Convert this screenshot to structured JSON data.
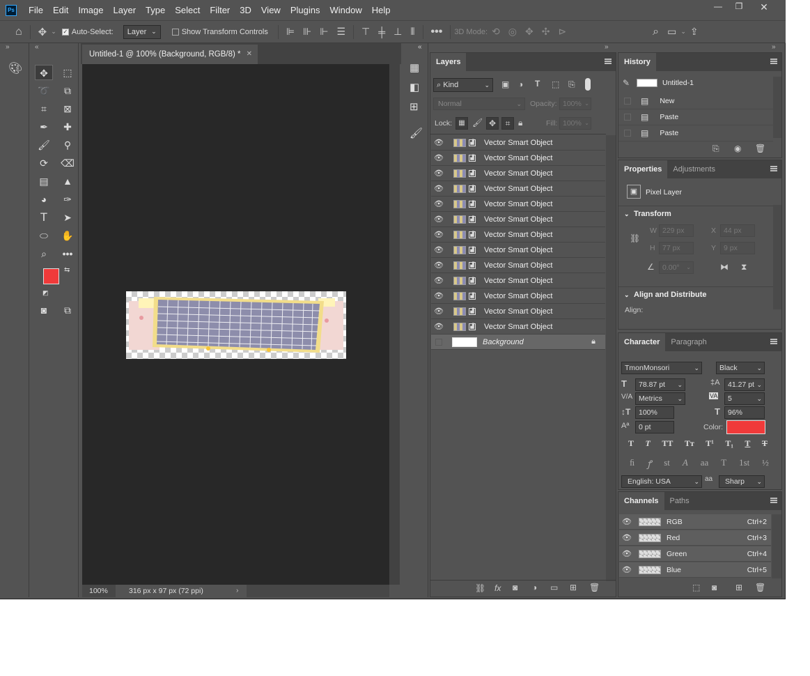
{
  "menubar": {
    "logo": "Ps",
    "items": [
      "File",
      "Edit",
      "Image",
      "Layer",
      "Type",
      "Select",
      "Filter",
      "3D",
      "View",
      "Plugins",
      "Window",
      "Help"
    ]
  },
  "options": {
    "auto_select_label": "Auto-Select:",
    "auto_select_value": "Layer",
    "show_transform_label": "Show Transform Controls",
    "mode_3d_label": "3D Mode:"
  },
  "document": {
    "tab_title": "Untitled-1 @ 100% (Background, RGB/8) *",
    "zoom": "100%",
    "size_info": "316 px x 97 px (72 ppi)"
  },
  "layers": {
    "tab": "Layers",
    "kind_label": "Kind",
    "blend_mode": "Normal",
    "opacity_label": "Opacity:",
    "opacity_value": "100%",
    "lock_label": "Lock:",
    "fill_label": "Fill:",
    "fill_value": "100%",
    "items": [
      "Vector Smart Object",
      "Vector Smart Object",
      "Vector Smart Object",
      "Vector Smart Object",
      "Vector Smart Object",
      "Vector Smart Object",
      "Vector Smart Object",
      "Vector Smart Object",
      "Vector Smart Object",
      "Vector Smart Object",
      "Vector Smart Object",
      "Vector Smart Object",
      "Vector Smart Object"
    ],
    "background_label": "Background"
  },
  "history": {
    "tab": "History",
    "snapshot": "Untitled-1",
    "items": [
      "New",
      "Paste",
      "Paste"
    ]
  },
  "properties": {
    "tabs": [
      "Properties",
      "Adjustments"
    ],
    "layer_type": "Pixel Layer",
    "transform_label": "Transform",
    "w_label": "W",
    "w_value": "229 px",
    "x_label": "X",
    "x_value": "44 px",
    "h_label": "H",
    "h_value": "77 px",
    "y_label": "Y",
    "y_value": "9 px",
    "angle_value": "0.00°",
    "align_label": "Align and Distribute",
    "align_sub": "Align:"
  },
  "character": {
    "tabs": [
      "Character",
      "Paragraph"
    ],
    "font_family": "TmonMonsori",
    "font_style": "Black",
    "font_size": "78.87 pt",
    "leading": "41.27 pt",
    "kerning": "Metrics",
    "tracking": "5",
    "vscale": "100%",
    "hscale": "96%",
    "baseline": "0 pt",
    "color_label": "Color:",
    "color_value": "#f03a3a",
    "language": "English: USA",
    "aa_label": "aa",
    "antialias": "Sharp"
  },
  "channels": {
    "tabs": [
      "Channels",
      "Paths"
    ],
    "items": [
      {
        "name": "RGB",
        "shortcut": "Ctrl+2"
      },
      {
        "name": "Red",
        "shortcut": "Ctrl+3"
      },
      {
        "name": "Green",
        "shortcut": "Ctrl+4"
      },
      {
        "name": "Blue",
        "shortcut": "Ctrl+5"
      }
    ]
  },
  "colors": {
    "foreground": "#f03a3a",
    "background": "#ffffff"
  }
}
